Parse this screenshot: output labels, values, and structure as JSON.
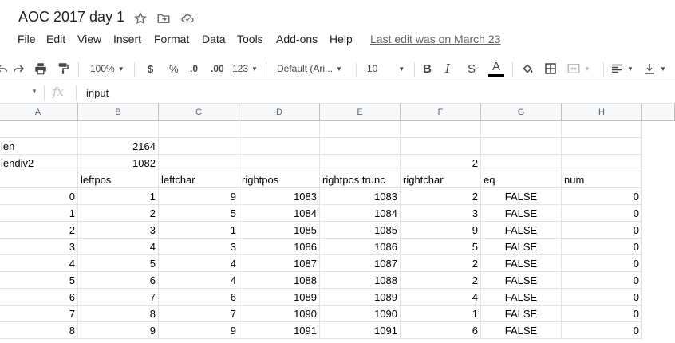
{
  "title": "AOC 2017 day 1",
  "menu": [
    "File",
    "Edit",
    "View",
    "Insert",
    "Format",
    "Data",
    "Tools",
    "Add-ons",
    "Help"
  ],
  "last_edit": "Last edit was on March 23",
  "toolbar": {
    "zoom": "100%",
    "currency": "$",
    "percent": "%",
    "decrease_decimal": ".0",
    "increase_decimal": ".00",
    "more_formats": "123",
    "font": "Default (Ari...",
    "font_size": "10",
    "bold": "B",
    "italic": "I",
    "strike": "S",
    "text_color": "A"
  },
  "formula_bar": {
    "fx": "fx",
    "content": "input"
  },
  "columns": [
    "A",
    "B",
    "C",
    "D",
    "E",
    "F",
    "G",
    "H"
  ],
  "rows": [
    [
      "",
      "",
      "",
      "",
      "",
      "",
      "",
      ""
    ],
    [
      "len",
      "2164",
      "",
      "",
      "",
      "",
      "",
      ""
    ],
    [
      "lendiv2",
      "1082",
      "",
      "",
      "",
      "2",
      "",
      ""
    ],
    [
      "",
      "leftpos",
      "leftchar",
      "rightpos",
      "rightpos trunc",
      "rightchar",
      "eq",
      "num"
    ],
    [
      "0",
      "1",
      "9",
      "1083",
      "1083",
      "2",
      "FALSE",
      "0"
    ],
    [
      "1",
      "2",
      "5",
      "1084",
      "1084",
      "3",
      "FALSE",
      "0"
    ],
    [
      "2",
      "3",
      "1",
      "1085",
      "1085",
      "9",
      "FALSE",
      "0"
    ],
    [
      "3",
      "4",
      "3",
      "1086",
      "1086",
      "5",
      "FALSE",
      "0"
    ],
    [
      "4",
      "5",
      "4",
      "1087",
      "1087",
      "2",
      "FALSE",
      "0"
    ],
    [
      "5",
      "6",
      "4",
      "1088",
      "1088",
      "2",
      "FALSE",
      "0"
    ],
    [
      "6",
      "7",
      "6",
      "1089",
      "1089",
      "4",
      "FALSE",
      "0"
    ],
    [
      "7",
      "8",
      "7",
      "1090",
      "1090",
      "1",
      "FALSE",
      "0"
    ],
    [
      "8",
      "9",
      "9",
      "1091",
      "1091",
      "6",
      "FALSE",
      "0"
    ]
  ],
  "text_color_bar": "#000000"
}
